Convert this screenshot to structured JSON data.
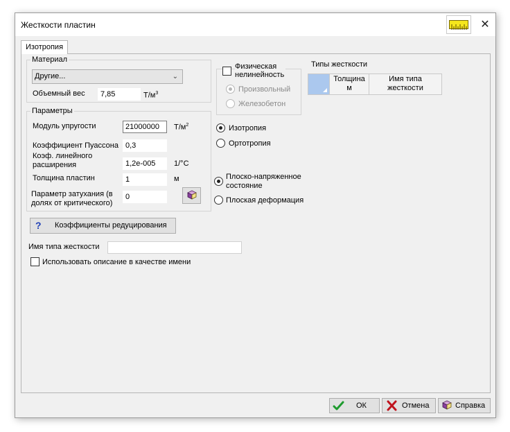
{
  "window": {
    "title": "Жесткости пластин",
    "close": "✕"
  },
  "tab": {
    "label": "Изотропия"
  },
  "material": {
    "group_label": "Материал",
    "dropdown_value": "Другие...",
    "weight_label": "Объемный вес",
    "weight_value": "7,85",
    "weight_unit_base": "Т/м",
    "weight_unit_exp": "3"
  },
  "nonlinear": {
    "checkbox_label_line1": "Физическая",
    "checkbox_label_line2": "нелинейность",
    "option_arbitrary": "Произвольный",
    "option_concrete": "Железобетон"
  },
  "parameters": {
    "group_label": "Параметры",
    "modulus_label": "Модуль упругости",
    "modulus_value": "21000000",
    "modulus_unit_base": "Т/м",
    "modulus_unit_exp": "2",
    "poisson_label": "Коэффициент Пуассона",
    "poisson_value": "0,3",
    "expansion_label_line1": "Коэф. линейного",
    "expansion_label_line2": "расширения",
    "expansion_value": "1,2e-005",
    "expansion_unit": "1/°C",
    "thickness_label": "Толщина пластин",
    "thickness_value": "1",
    "thickness_unit": "м",
    "damping_label_line1": "Параметр затухания (в",
    "damping_label_line2": "долях от критического)",
    "damping_value": "0"
  },
  "isotropy_radio": {
    "isotropy": "Изотропия",
    "orthotropy": "Ортотропия"
  },
  "stress_radio": {
    "plane_stress_line1": "Плоско-напряженное",
    "plane_stress_line2": "состояние",
    "plane_strain": "Плоская деформация"
  },
  "stiffness_types": {
    "label": "Типы жесткости",
    "col_thickness_line1": "Толщина",
    "col_thickness_line2": "м",
    "col_name_line1": "Имя типа",
    "col_name_line2": "жесткости"
  },
  "reduction_button": {
    "label": "Коэффициенты редуцирования"
  },
  "stiffness_name": {
    "label": "Имя типа жесткости",
    "value": ""
  },
  "use_description": {
    "label": "Использовать описание в качестве имени"
  },
  "footer": {
    "ok": "ОК",
    "cancel": "Отмена",
    "help": "Справка"
  },
  "colors": {
    "accent_grid": "#abc8ee",
    "ruler_yellow": "#f5e61c",
    "ok_green": "#1e9b2e",
    "cancel_red": "#c0131d",
    "help_blue": "#1f3fb6"
  }
}
